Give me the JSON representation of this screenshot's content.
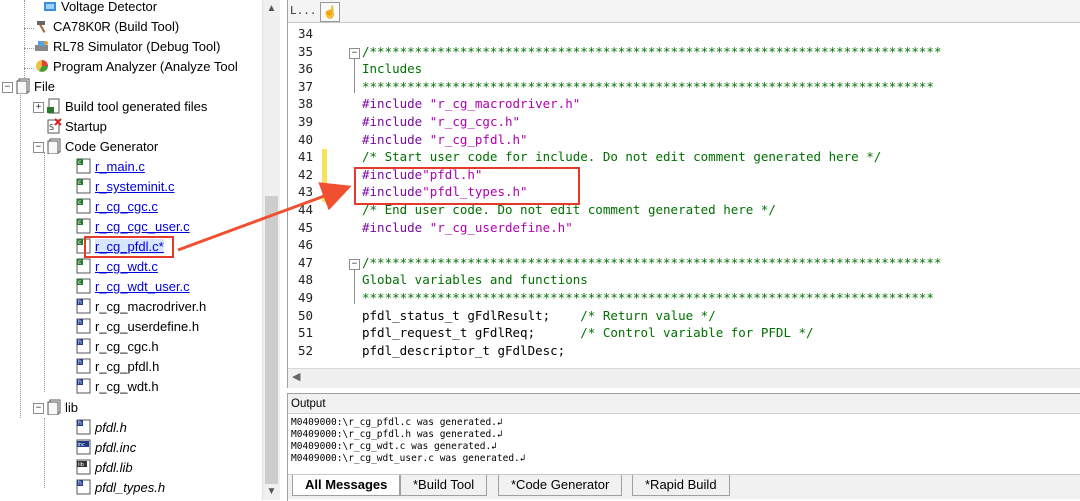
{
  "tree": {
    "items": [
      {
        "label": "Voltage Detector"
      },
      {
        "label": "CA78K0R (Build Tool)"
      },
      {
        "label": "RL78 Simulator (Debug Tool)"
      },
      {
        "label": "Program Analyzer (Analyze Tool"
      },
      {
        "label": "File"
      },
      {
        "label": "Build tool generated files"
      },
      {
        "label": "Startup"
      },
      {
        "label": "Code Generator"
      },
      {
        "label": "r_main.c"
      },
      {
        "label": "r_systeminit.c"
      },
      {
        "label": "r_cg_cgc.c"
      },
      {
        "label": "r_cg_cgc_user.c"
      },
      {
        "label": "r_cg_pfdl.c*"
      },
      {
        "label": "r_cg_wdt.c"
      },
      {
        "label": "r_cg_wdt_user.c"
      },
      {
        "label": "r_cg_macrodriver.h"
      },
      {
        "label": "r_cg_userdefine.h"
      },
      {
        "label": "r_cg_cgc.h"
      },
      {
        "label": "r_cg_pfdl.h"
      },
      {
        "label": "r_cg_wdt.h"
      },
      {
        "label": "lib"
      },
      {
        "label": "pfdl.h"
      },
      {
        "label": "pfdl.inc"
      },
      {
        "label": "pfdl.lib"
      },
      {
        "label": "pfdl_types.h"
      }
    ]
  },
  "editor": {
    "header_label": "L...",
    "lines": [
      {
        "n": "34",
        "text": ""
      },
      {
        "n": "35",
        "text": "/****************************************************************************"
      },
      {
        "n": "36",
        "text": "Includes"
      },
      {
        "n": "37",
        "text": "****************************************************************************"
      },
      {
        "n": "38",
        "kw": "#include",
        "rest": " \"r_cg_macrodriver.h\""
      },
      {
        "n": "39",
        "kw": "#include",
        "rest": " \"r_cg_cgc.h\""
      },
      {
        "n": "40",
        "kw": "#include",
        "rest": " \"r_cg_pfdl.h\""
      },
      {
        "n": "41",
        "text": "/* Start user code for include. Do not edit comment generated here */"
      },
      {
        "n": "42",
        "kw": "#include",
        "rest": "\"pfdl.h\""
      },
      {
        "n": "43",
        "kw": "#include",
        "rest": "\"pfdl_types.h\""
      },
      {
        "n": "44",
        "text": "/* End user code. Do not edit comment generated here */"
      },
      {
        "n": "45",
        "kw": "#include",
        "rest": " \"r_cg_userdefine.h\""
      },
      {
        "n": "46",
        "text": ""
      },
      {
        "n": "47",
        "text": "/****************************************************************************"
      },
      {
        "n": "48",
        "text": "Global variables and functions"
      },
      {
        "n": "49",
        "text": "****************************************************************************"
      },
      {
        "n": "50",
        "code": "pfdl_status_t gFdlResult;",
        "comment": "    /* Return value */"
      },
      {
        "n": "51",
        "code": "pfdl_request_t gFdlReq;",
        "comment": "      /* Control variable for PFDL */"
      },
      {
        "n": "52",
        "code": "pfdl_descriptor_t gFdlDesc;",
        "comment": ""
      }
    ]
  },
  "output": {
    "title": "Output",
    "lines": [
      "M0409000:\\r_cg_pfdl.c was generated.↲",
      "M0409000:\\r_cg_pfdl.h was generated.↲",
      "M0409000:\\r_cg_wdt.c was generated.↲",
      "M0409000:\\r_cg_wdt_user.c was generated.↲"
    ],
    "tabs": [
      {
        "label": "All Messages",
        "active": true
      },
      {
        "label": "*Build Tool",
        "active": false
      },
      {
        "label": "*Code Generator",
        "active": false
      },
      {
        "label": "*Rapid Build",
        "active": false
      }
    ]
  },
  "colors": {
    "highlight_box": "#e53a2a",
    "link_blue": "#0000e0",
    "comment_green": "#007000",
    "keyword_purple": "#7a0aa0"
  }
}
